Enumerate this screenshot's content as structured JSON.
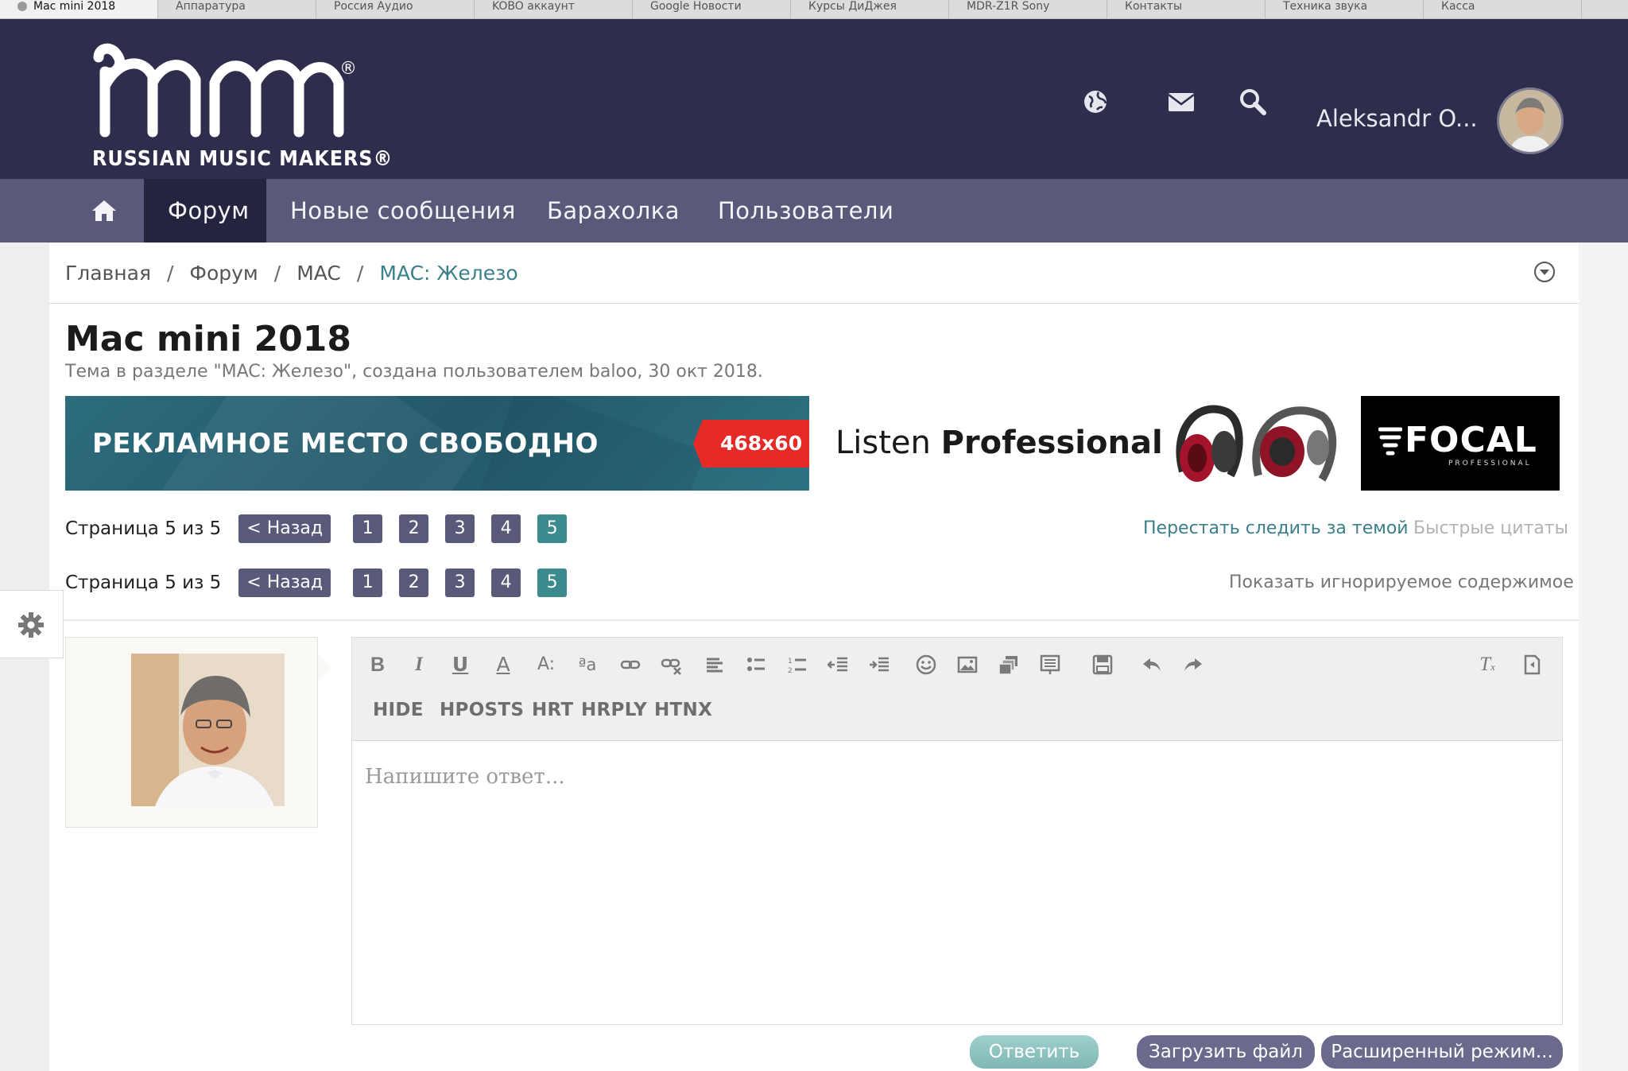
{
  "browser": {
    "tabs": [
      "Mac mini 2018",
      "Аппаратура",
      "Россия Аудио",
      "KOBO аккаунт",
      "Google Новости",
      "Курсы ДиДжея",
      "MDR-Z1R Sony",
      "Контакты",
      "Техника звука",
      "Касса"
    ]
  },
  "header": {
    "logo_mark": "rmm",
    "logo_registered": "®",
    "logo_subtitle": "RUSSIAN MUSIC MAKERS®",
    "user_name": "Aleksandr O...",
    "icons": [
      "globe-icon",
      "envelope-icon",
      "search-icon"
    ]
  },
  "nav": {
    "home_icon": "home-icon",
    "items": [
      "Форум",
      "Новые сообщения",
      "Барахолка",
      "Пользователи"
    ],
    "active": "Форум"
  },
  "breadcrumb": {
    "items": [
      "Главная",
      "Форум",
      "MAC"
    ],
    "separator": "/",
    "current": "MAC: Железо"
  },
  "thread": {
    "title": "Mac mini 2018",
    "subtitle": "Тема в разделе \"MAC: Железо\", создана пользователем baloo, 30 окт 2018."
  },
  "banners": {
    "ad_text": "РЕКЛАМНОЕ  МЕСТО СВОБОДНО",
    "ad_size": "468x60",
    "focal_text_light": "Listen ",
    "focal_text_bold": "Professional",
    "focal_logo": "FOCAL",
    "focal_logo_sub": "PROFESSIONAL"
  },
  "pagination": {
    "label": "Страница 5 из 5",
    "back": "< Назад",
    "pages": [
      "1",
      "2",
      "3",
      "4",
      "5"
    ],
    "current": "5"
  },
  "thread_links": {
    "unwatch": "Перестать следить за темой",
    "quick_quotes": "Быстрые цитаты",
    "show_ignored": "Показать игнорируемое содержимое"
  },
  "editor": {
    "text_buttons": [
      "HIDE",
      "HPOSTS",
      "HRT",
      "HRPLY",
      "HTNX"
    ],
    "placeholder": "Напишите ответ...",
    "toolbar_icons": [
      "bold-icon",
      "italic-icon",
      "underline-icon",
      "text-color-icon",
      "font-size-icon",
      "font-family-icon",
      "link-icon",
      "unlink-icon",
      "align-icon",
      "bullet-list-icon",
      "numbered-list-icon",
      "outdent-icon",
      "indent-icon",
      "smilie-icon",
      "image-icon",
      "media-icon",
      "code-icon",
      "save-draft-icon",
      "undo-icon",
      "redo-icon",
      "remove-format-icon",
      "toggle-bbcode-icon"
    ]
  },
  "actions": {
    "reply": "Ответить",
    "upload": "Загрузить файл",
    "advanced": "Расширенный режим..."
  },
  "colors": {
    "header_bg": "#2e2d4c",
    "nav_bg": "#595a7a",
    "nav_active": "#25243f",
    "accent_teal": "#3a8a8e",
    "link_teal": "#3a7f8a"
  }
}
